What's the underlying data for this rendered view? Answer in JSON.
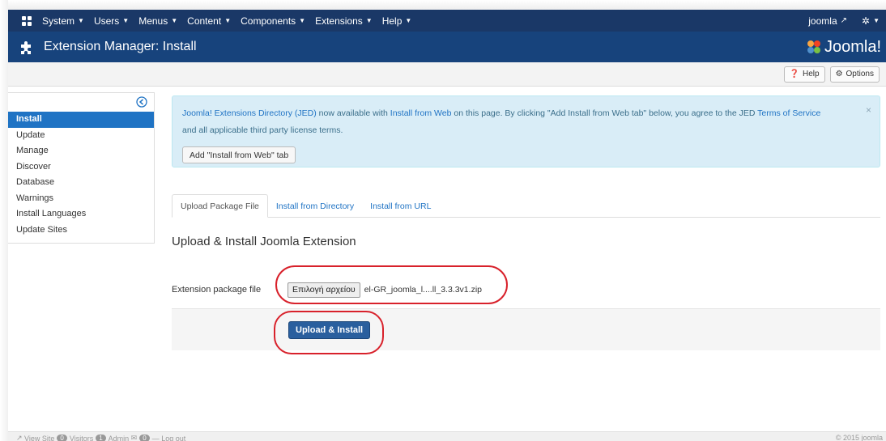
{
  "menubar": {
    "items": [
      {
        "label": "System"
      },
      {
        "label": "Users"
      },
      {
        "label": "Menus"
      },
      {
        "label": "Content"
      },
      {
        "label": "Components"
      },
      {
        "label": "Extensions"
      },
      {
        "label": "Help"
      }
    ],
    "user_label": "joomla"
  },
  "titlebar": {
    "title": "Extension Manager: Install",
    "brand": "Joomla!"
  },
  "toolbar": {
    "help_label": "Help",
    "options_label": "Options"
  },
  "sidebar": {
    "items": [
      {
        "label": "Install",
        "active": true
      },
      {
        "label": "Update"
      },
      {
        "label": "Manage"
      },
      {
        "label": "Discover"
      },
      {
        "label": "Database"
      },
      {
        "label": "Warnings"
      },
      {
        "label": "Install Languages"
      },
      {
        "label": "Update Sites"
      }
    ]
  },
  "alert": {
    "jed_link": "Joomla! Extensions Directory (JED)",
    "text_a": " now available with ",
    "install_web_link": "Install from Web",
    "text_b": " on this page.  By clicking \"Add Install from Web tab\" below, you agree to the JED ",
    "tos_link": "Terms of Service",
    "line2": "and all applicable third party license terms.",
    "close": "×",
    "add_button": "Add \"Install from Web\" tab"
  },
  "tabs": [
    {
      "label": "Upload Package File",
      "active": true
    },
    {
      "label": "Install from Directory"
    },
    {
      "label": "Install from URL"
    }
  ],
  "section_title": "Upload & Install Joomla Extension",
  "form": {
    "label": "Extension package file",
    "file_button": "Επιλογή αρχείου",
    "file_name": "el-GR_joomla_l....ll_3.3.3v1.zip"
  },
  "action": {
    "upload_button": "Upload & Install"
  },
  "footer": {
    "view_site": "View Site",
    "visitors_count": "0",
    "visitors": "Visitors",
    "admin_count": "1",
    "admin": "Admin",
    "messages_count": "0",
    "logout": "Log out",
    "copyright": "© 2015 joomla"
  },
  "colors": {
    "menubar": "#1a3867",
    "titlebar": "#17437c",
    "accent": "#1f73c4",
    "highlight": "#d8212b"
  }
}
